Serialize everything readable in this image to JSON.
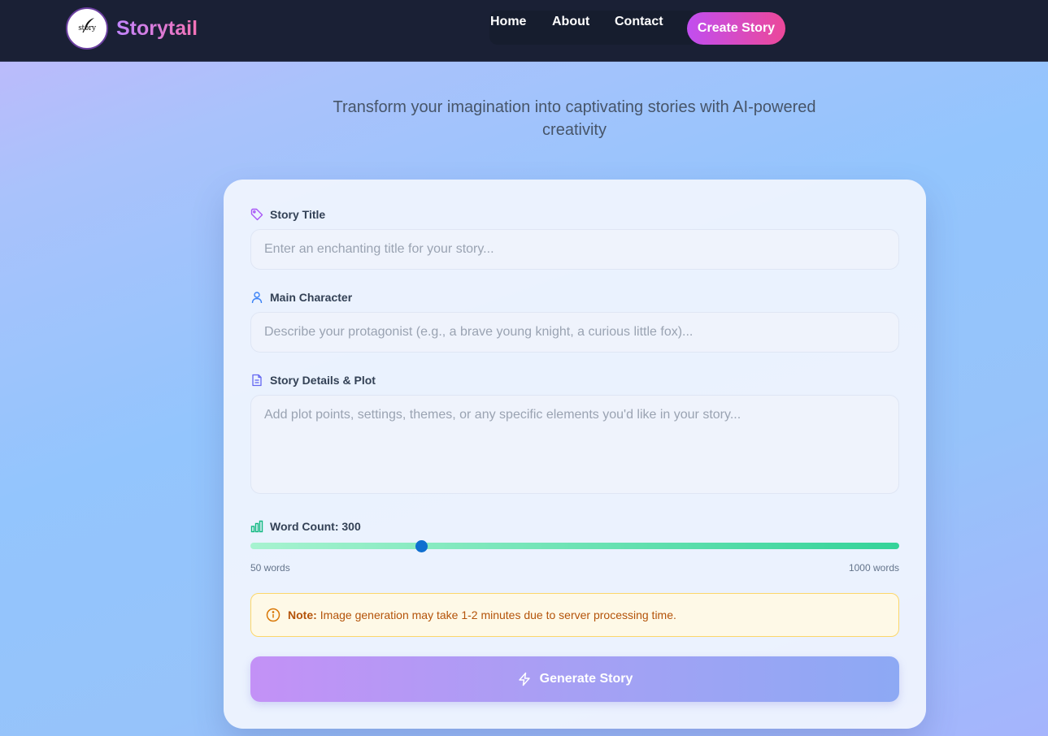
{
  "header": {
    "brand": "Storytail",
    "logo_text": "story",
    "nav": [
      {
        "label": "Home"
      },
      {
        "label": "About"
      },
      {
        "label": "Contact"
      }
    ],
    "cta_label": "Create Story"
  },
  "hero": {
    "tagline": "Transform your imagination into captivating stories with AI-powered creativity"
  },
  "form": {
    "title": {
      "label": "Story Title",
      "icon": "tag-icon",
      "placeholder": "Enter an enchanting title for your story...",
      "value": ""
    },
    "character": {
      "label": "Main Character",
      "icon": "user-icon",
      "placeholder": "Describe your protagonist (e.g., a brave young knight, a curious little fox)...",
      "value": ""
    },
    "details": {
      "label": "Story Details & Plot",
      "icon": "document-icon",
      "placeholder": "Add plot points, settings, themes, or any specific elements you'd like in your story...",
      "value": ""
    },
    "word_count": {
      "label": "Word Count: 300",
      "icon": "bar-chart-icon",
      "value": 300,
      "min": 50,
      "max": 1000,
      "min_label": "50 words",
      "max_label": "1000 words"
    },
    "note": {
      "icon": "info-circle-icon",
      "strong": "Note:",
      "text": "Image generation may take 1-2 minutes due to server processing time."
    },
    "submit": {
      "label": "Generate Story",
      "icon": "lightning-icon"
    }
  },
  "colors": {
    "navbar": "#1a2035",
    "brand_gradient": [
      "#c084fc",
      "#f472b6"
    ],
    "cta_gradient": [
      "#c14ef0",
      "#ec4899"
    ],
    "slider_thumb": "#0f6fcf",
    "slider_track": [
      "#a7f3d0",
      "#34d399"
    ],
    "note_bg": "#fef9e7",
    "note_text": "#b45309"
  }
}
